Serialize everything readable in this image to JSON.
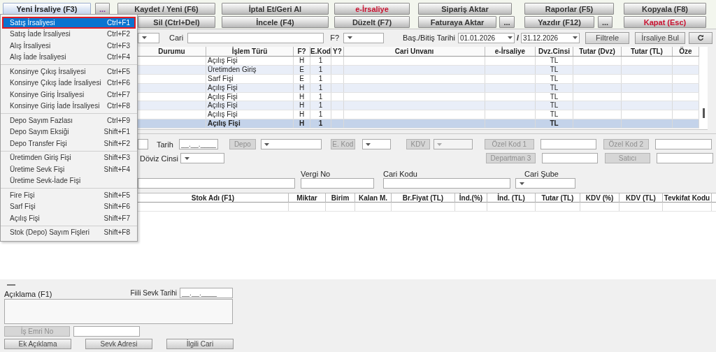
{
  "toolbar": {
    "top_buttons": [
      {
        "label": "Yeni İrsaliye (F3)",
        "kind": "menu"
      },
      {
        "label": "...",
        "kind": "more"
      },
      {
        "label": "Kaydet / Yeni (F6)",
        "kind": "normal"
      },
      {
        "label": "İptal Et/Geri Al",
        "kind": "normal"
      },
      {
        "label": "e-İrsaliye",
        "kind": "alert"
      },
      {
        "label": "Sipariş Aktar",
        "kind": "normal"
      },
      {
        "label": "Raporlar (F5)",
        "kind": "normal"
      },
      {
        "label": "Kopyala (F8)",
        "kind": "normal"
      }
    ],
    "bottom_buttons": [
      {
        "label": "Sil (Ctrl+Del)",
        "kind": "normal"
      },
      {
        "label": "İncele (F4)",
        "kind": "normal"
      },
      {
        "label": "Düzelt (F7)",
        "kind": "normal"
      },
      {
        "label": "Faturaya Aktar",
        "kind": "normal"
      },
      {
        "label": "...",
        "kind": "normal"
      },
      {
        "label": "Yazdır (F12)",
        "kind": "normal"
      },
      {
        "label": "...",
        "kind": "normal"
      },
      {
        "label": "Kapat (Esc)",
        "kind": "alert"
      }
    ]
  },
  "filter": {
    "cari_label": "Cari",
    "f_label": "F?",
    "date_label": "Baş./Bitiş Tarihi",
    "start_date": "01.01.2026",
    "separator": "/",
    "end_date": "31.12.2026",
    "buttons": [
      "Filtrele",
      "İrsaliye Bul"
    ]
  },
  "list": {
    "columns": [
      "Durumu",
      "İşlem Türü",
      "F?",
      "E.Kod",
      "Y?",
      "Cari Unvanı",
      "e-İrsaliye",
      "Dvz.Cinsi",
      "Tutar (Dvz)",
      "Tutar (TL)",
      "Öze"
    ],
    "rows": [
      {
        "islem_turu": "Açılış Fişi",
        "f": "H",
        "e_kod": "1",
        "dvz_cinsi": "TL",
        "selected": false
      },
      {
        "islem_turu": "Üretimden Giriş",
        "f": "E",
        "e_kod": "1",
        "dvz_cinsi": "TL",
        "selected": false
      },
      {
        "islem_turu": "Sarf Fişi",
        "f": "E",
        "e_kod": "1",
        "dvz_cinsi": "TL",
        "selected": false
      },
      {
        "islem_turu": "Açılış Fişi",
        "f": "H",
        "e_kod": "1",
        "dvz_cinsi": "TL",
        "selected": false
      },
      {
        "islem_turu": "Açılış Fişi",
        "f": "H",
        "e_kod": "1",
        "dvz_cinsi": "TL",
        "selected": false
      },
      {
        "islem_turu": "Açılış Fişi",
        "f": "H",
        "e_kod": "1",
        "dvz_cinsi": "TL",
        "selected": false
      },
      {
        "islem_turu": "Açılış Fişi",
        "f": "H",
        "e_kod": "1",
        "dvz_cinsi": "TL",
        "selected": false
      },
      {
        "islem_turu": "Açılış Fişi",
        "f": "H",
        "e_kod": "1",
        "dvz_cinsi": "TL",
        "selected": true
      }
    ]
  },
  "form": {
    "date_label": "Tarih",
    "date_value": "__.__.____",
    "depo_button": {
      "label": "Depo",
      "disabled": true
    },
    "ekod_button": {
      "label": "E. Kod",
      "disabled": true
    },
    "kdv_button": {
      "label": "KDV",
      "disabled": true
    },
    "kdv_combo": {
      "disabled": true
    },
    "code_buttons": [
      {
        "label": "Özel Kod 1",
        "disabled": true
      },
      {
        "label": "Özel Kod 2",
        "disabled": true
      },
      {
        "label": "Departman 3",
        "disabled": true
      },
      {
        "label": "Satıcı",
        "disabled": true
      }
    ],
    "currency_label": "Döviz Cinsi",
    "vergi_label": "Vergi No",
    "cari_kodu_label": "Cari Kodu",
    "cari_sube_label": "Cari Şube"
  },
  "items_table": {
    "columns": [
      "Stok Adı (F1)",
      "Miktar",
      "Birim",
      "Kalan M.",
      "Br.Fiyat (TL)",
      "İnd.(%)",
      "İnd. (TL)",
      "Tutar (TL)",
      "KDV (%)",
      "KDV (TL)",
      "Tevkifat Kodu"
    ]
  },
  "footer": {
    "note_label": "Açıklama (F1)",
    "ship_date_label": "Fiili Sevk Tarihi",
    "ship_date_value": "__.__.____",
    "work_order_button": {
      "label": "İş Emri No",
      "disabled": true
    },
    "buttons": [
      "Ek Açıklama",
      "Sevk Adresi",
      "İlgili Cari"
    ]
  },
  "menu": {
    "groups": [
      {
        "items": [
          {
            "label": "Satış İrsaliyesi",
            "shortcut": "Ctrl+F1",
            "selected": true
          },
          {
            "label": "Satış İade İrsaliyesi",
            "shortcut": "Ctrl+F2",
            "selected": false
          },
          {
            "label": "Alış İrsaliyesi",
            "shortcut": "Ctrl+F3",
            "selected": false
          },
          {
            "label": "Alış İade İrsaliyesi",
            "shortcut": "Ctrl+F4",
            "selected": false
          }
        ]
      },
      {
        "items": [
          {
            "label": "Konsinye Çıkış İrsaliyesi",
            "shortcut": "Ctrl+F5",
            "selected": false
          },
          {
            "label": "Konsinye Çıkış İade İrsaliyesi",
            "shortcut": "Ctrl+F6",
            "selected": false
          },
          {
            "label": "Konsinye Giriş İrsaliyesi",
            "shortcut": "Ctrl+F7",
            "selected": false
          },
          {
            "label": "Konsinye Giriş İade İrsaliyesi",
            "shortcut": "Ctrl+F8",
            "selected": false
          }
        ]
      },
      {
        "items": [
          {
            "label": "Depo Sayım Fazlası",
            "shortcut": "Ctrl+F9",
            "selected": false
          },
          {
            "label": "Depo Sayım Eksiği",
            "shortcut": "Shift+F1",
            "selected": false
          },
          {
            "label": "Depo Transfer Fişi",
            "shortcut": "Shift+F2",
            "selected": false
          }
        ]
      },
      {
        "items": [
          {
            "label": "Üretimden Giriş Fişi",
            "shortcut": "Shift+F3",
            "selected": false
          },
          {
            "label": "Üretime Sevk Fişi",
            "shortcut": "Shift+F4",
            "selected": false
          },
          {
            "label": "Üretime Sevk-İade Fişi",
            "selected": false
          }
        ]
      },
      {
        "items": [
          {
            "label": "Fire Fişi",
            "shortcut": "Shift+F5",
            "selected": false
          },
          {
            "label": "Sarf Fişi",
            "shortcut": "Shift+F6",
            "selected": false
          },
          {
            "label": "Açılış Fişi",
            "shortcut": "Shift+F7",
            "selected": false
          }
        ]
      },
      {
        "items": [
          {
            "label": "Stok (Depo) Sayım Fişleri",
            "shortcut": "Shift+F8",
            "selected": false
          }
        ]
      }
    ]
  }
}
